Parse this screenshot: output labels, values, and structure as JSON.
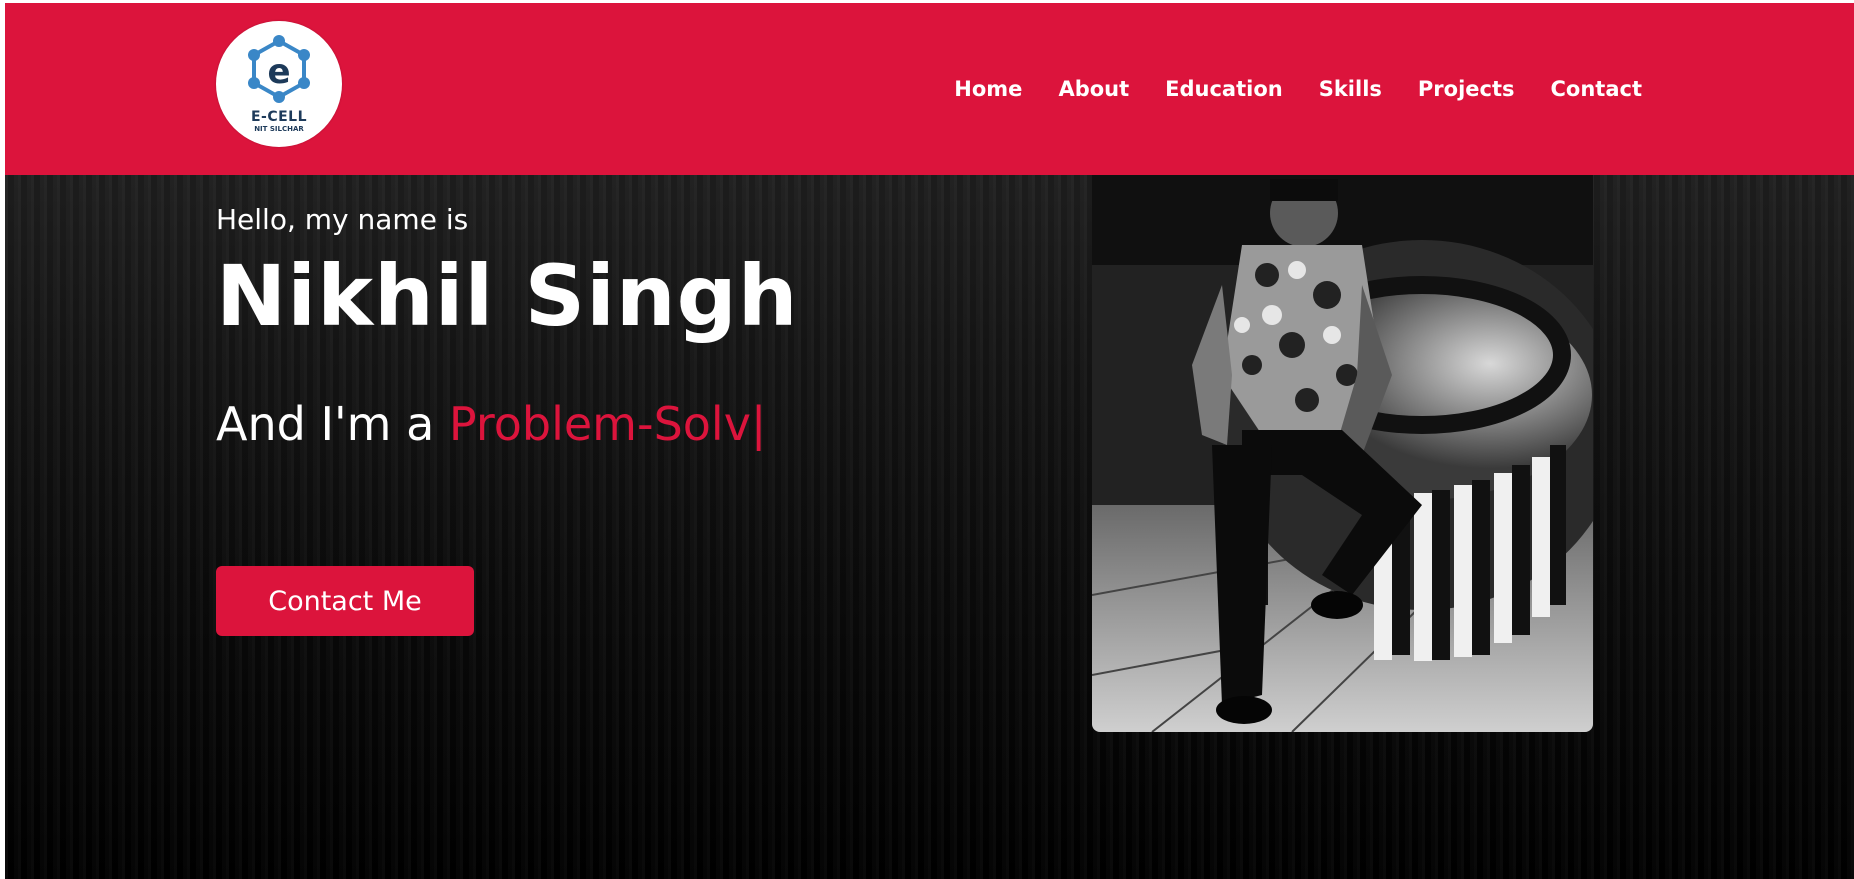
{
  "logo": {
    "title": "E-CELL",
    "subtitle": "NIT SILCHAR"
  },
  "nav": {
    "items": [
      {
        "label": "Home"
      },
      {
        "label": "About"
      },
      {
        "label": "Education"
      },
      {
        "label": "Skills"
      },
      {
        "label": "Projects"
      },
      {
        "label": "Contact"
      }
    ]
  },
  "hero": {
    "greeting": "Hello, my name is",
    "name": "Nikhil Singh",
    "role_prefix": "And I'm a",
    "role_typed": "Problem-Solv",
    "cursor": "|",
    "cta_label": "Contact Me"
  },
  "colors": {
    "accent": "#dc143c",
    "background": "#000000",
    "text": "#ffffff"
  }
}
